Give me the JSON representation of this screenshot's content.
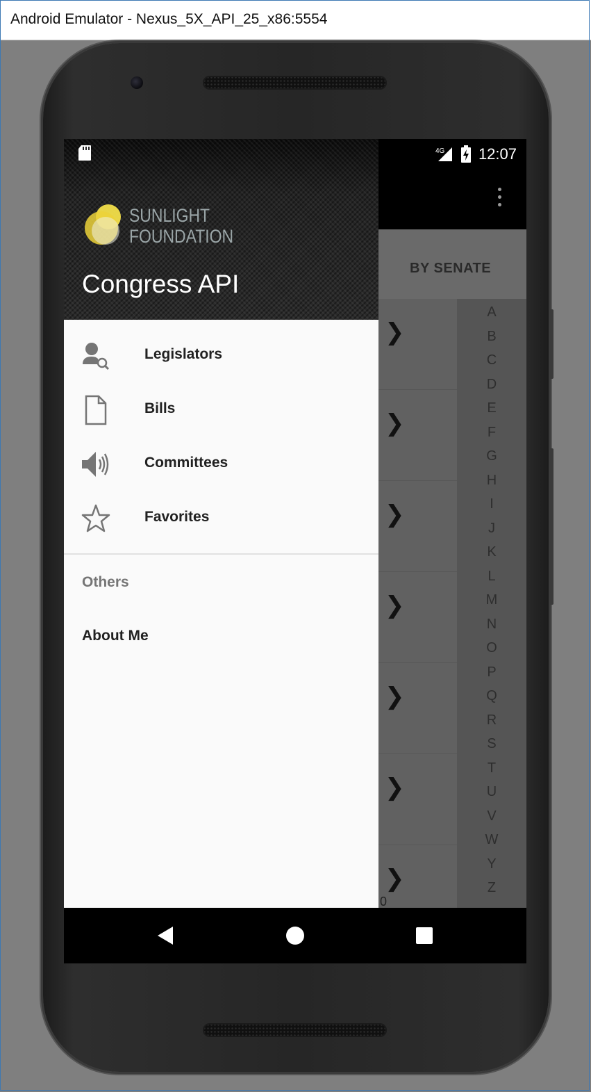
{
  "window": {
    "title": "Android Emulator - Nexus_5X_API_25_x86:5554"
  },
  "status_bar": {
    "network": "4G",
    "time": "12:07"
  },
  "app": {
    "tab_label": "BY SENATE",
    "index_letters": [
      "A",
      "B",
      "C",
      "D",
      "E",
      "F",
      "G",
      "H",
      "I",
      "J",
      "K",
      "L",
      "M",
      "N",
      "O",
      "P",
      "Q",
      "R",
      "S",
      "T",
      "U",
      "V",
      "W",
      "Y",
      "Z"
    ],
    "list_row_count": 7,
    "partial_row_text": "0"
  },
  "drawer": {
    "logo": {
      "line1": "SUNLIGHT",
      "line2": "FOUNDATION"
    },
    "app_name": "Congress API",
    "items": [
      {
        "label": "Legislators",
        "icon": "legislator-search-icon"
      },
      {
        "label": "Bills",
        "icon": "document-icon"
      },
      {
        "label": "Committees",
        "icon": "speaker-icon"
      },
      {
        "label": "Favorites",
        "icon": "star-icon"
      }
    ],
    "section_label": "Others",
    "about_label": "About Me"
  },
  "colors": {
    "drawer_bg": "#fafafa",
    "scrim_list": "#616161",
    "logo_yellow": "#f3df4a",
    "icon_gray": "#757575"
  }
}
